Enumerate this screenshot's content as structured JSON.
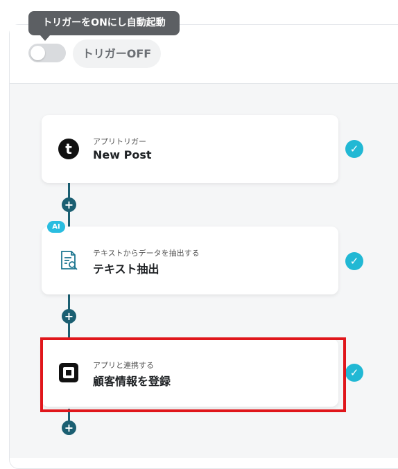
{
  "header": {
    "tooltip": "トリガーをONにし自動起動",
    "trigger_status": "トリガーOFF",
    "toggle_on": false
  },
  "steps": [
    {
      "subtitle": "アプリトリガー",
      "title": "New Post",
      "icon": "tumblr-icon",
      "ai": false,
      "completed": true
    },
    {
      "subtitle": "テキストからデータを抽出する",
      "title": "テキスト抽出",
      "icon": "document-search-icon",
      "ai": true,
      "ai_label": "AI",
      "completed": true
    },
    {
      "subtitle": "アプリと連携する",
      "title": "顧客情報を登録",
      "icon": "square-pos-icon",
      "ai": false,
      "completed": true
    }
  ],
  "colors": {
    "accent": "#21b8d4",
    "connector": "#1b5f72",
    "highlight": "#e0161b",
    "ai_badge": "#29bde0"
  }
}
